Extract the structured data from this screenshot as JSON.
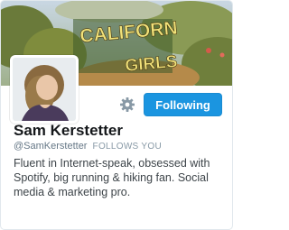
{
  "banner": {
    "sign_line1": "CALIFORN",
    "sign_line2": "GIRLS"
  },
  "actions": {
    "follow_label": "Following"
  },
  "profile": {
    "name": "Sam Kerstetter",
    "handle": "@SamKerstetter",
    "follows_you": "FOLLOWS YOU",
    "bio": "Fluent in Internet-speak, obsessed with Spotify, big running & hiking fan. Social media & marketing pro."
  },
  "colors": {
    "accent": "#1b95e0",
    "name": "#14171a",
    "muted": "#657786"
  }
}
